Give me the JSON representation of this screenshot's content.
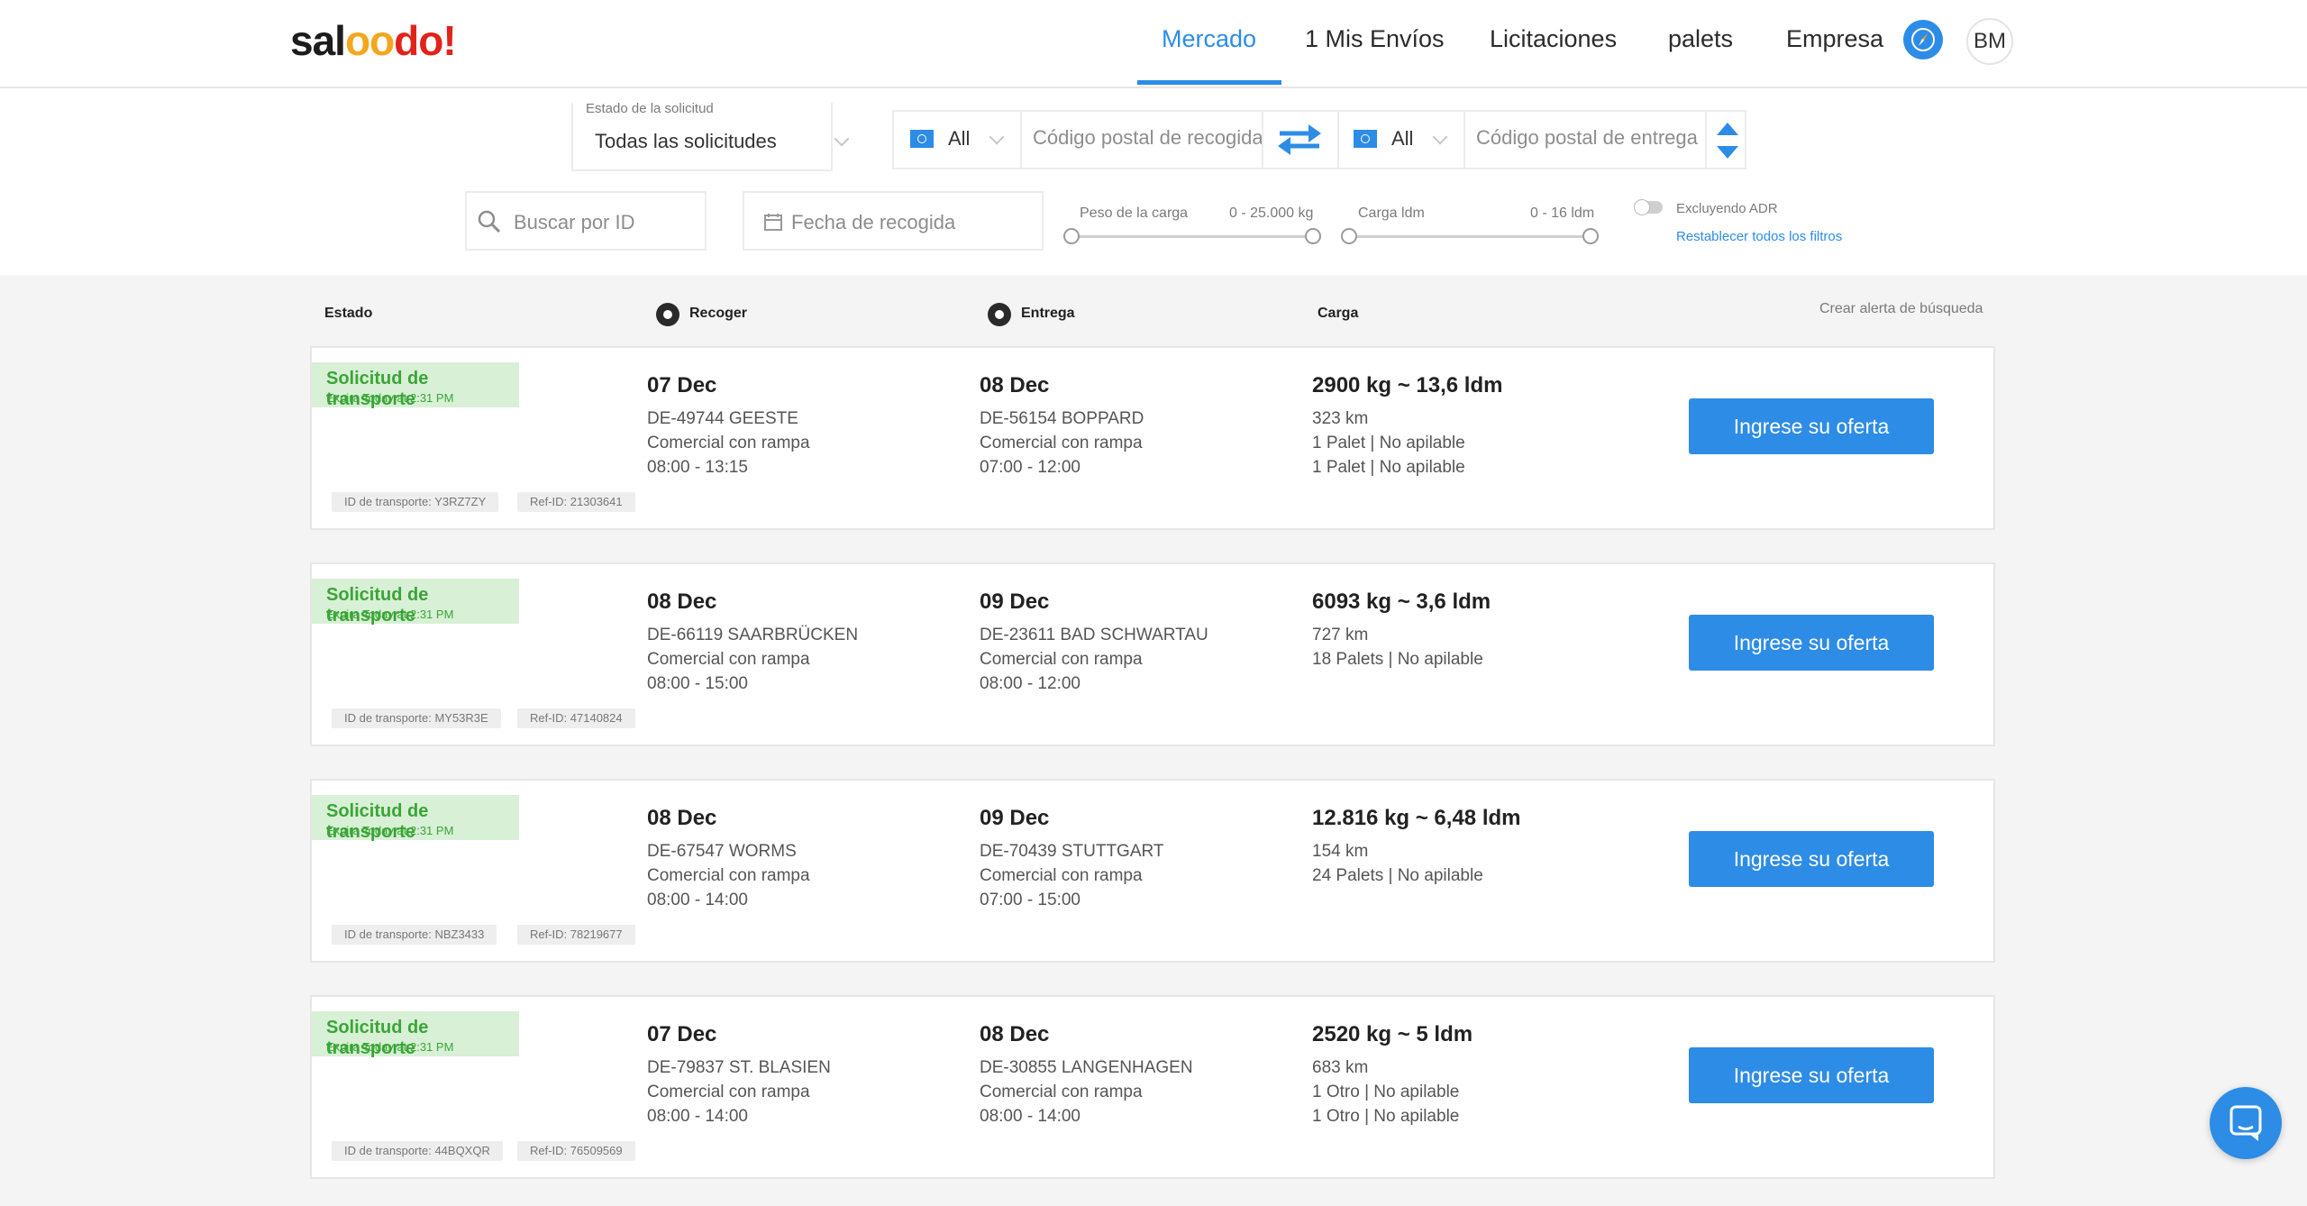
{
  "brand": {
    "logo_part1": "sal",
    "logo_part2": "oo",
    "logo_part3": "do!"
  },
  "nav": {
    "items": [
      {
        "label": "Mercado",
        "active": true
      },
      {
        "label": "1 Mis Envíos"
      },
      {
        "label": "Licitaciones"
      },
      {
        "label": "palets"
      },
      {
        "label": "Empresa"
      }
    ],
    "avatar_initials": "BM"
  },
  "filters": {
    "status_label": "Estado de la solicitud",
    "status_value": "Todas las solicitudes",
    "pickup_country": "All",
    "pickup_zip_placeholder": "Código postal de recogida",
    "delivery_country": "All",
    "delivery_zip_placeholder": "Código postal de entrega",
    "search_id_placeholder": "Buscar por ID",
    "pickup_date_placeholder": "Fecha de recogida",
    "weight_label": "Peso de la carga",
    "weight_range": "0 - 25.000 kg",
    "ldm_label": "Carga ldm",
    "ldm_range": "0 - 16 ldm",
    "adr_label": "Excluyendo ADR",
    "reset_link": "Restablecer todos los filtros"
  },
  "columns": {
    "estado": "Estado",
    "recoger": "Recoger",
    "entrega": "Entrega",
    "carga": "Carga",
    "alert": "Crear alerta de búsqueda"
  },
  "listings": [
    {
      "status": "Solicitud de transporte",
      "expires": "Expira Today at 2:31 PM",
      "transport_id": "ID de transporte: Y3RZ7ZY",
      "ref_id": "Ref-ID: 21303641",
      "pickup": {
        "date": "07 Dec",
        "place": "DE-49744 GEESTE",
        "type": "Comercial con rampa",
        "hours": "08:00 - 13:15"
      },
      "delivery": {
        "date": "08 Dec",
        "place": "DE-56154 BOPPARD",
        "type": "Comercial con rampa",
        "hours": "07:00 - 12:00"
      },
      "cargo": {
        "weight": "2900 kg ~ 13,6 ldm",
        "distance": "323 km",
        "lines": [
          "1 Palet | No apilable",
          "1 Palet | No apilable"
        ]
      },
      "button": "Ingrese su oferta"
    },
    {
      "status": "Solicitud de transporte",
      "expires": "Expira Today at 2:31 PM",
      "transport_id": "ID de transporte: MY53R3E",
      "ref_id": "Ref-ID: 47140824",
      "pickup": {
        "date": "08 Dec",
        "place": "DE-66119 SAARBRÜCKEN",
        "type": "Comercial con rampa",
        "hours": "08:00 - 15:00"
      },
      "delivery": {
        "date": "09 Dec",
        "place": "DE-23611 BAD SCHWARTAU",
        "type": "Comercial con rampa",
        "hours": "08:00 - 12:00"
      },
      "cargo": {
        "weight": "6093 kg ~ 3,6 ldm",
        "distance": "727 km",
        "lines": [
          "18 Palets | No apilable"
        ]
      },
      "button": "Ingrese su oferta"
    },
    {
      "status": "Solicitud de transporte",
      "expires": "Expira Today at 2:31 PM",
      "transport_id": "ID de transporte: NBZ3433",
      "ref_id": "Ref-ID: 78219677",
      "pickup": {
        "date": "08 Dec",
        "place": "DE-67547 WORMS",
        "type": "Comercial con rampa",
        "hours": "08:00 - 14:00"
      },
      "delivery": {
        "date": "09 Dec",
        "place": "DE-70439 STUTTGART",
        "type": "Comercial con rampa",
        "hours": "07:00 - 15:00"
      },
      "cargo": {
        "weight": "12.816 kg ~ 6,48 ldm",
        "distance": "154 km",
        "lines": [
          "24 Palets | No apilable"
        ]
      },
      "button": "Ingrese su oferta"
    },
    {
      "status": "Solicitud de transporte",
      "expires": "Expira Today at 2:31 PM",
      "transport_id": "ID de transporte: 44BQXQR",
      "ref_id": "Ref-ID: 76509569",
      "pickup": {
        "date": "07 Dec",
        "place": "DE-79837 ST. BLASIEN",
        "type": "Comercial con rampa",
        "hours": "08:00 - 14:00"
      },
      "delivery": {
        "date": "08 Dec",
        "place": "DE-30855 LANGENHAGEN",
        "type": "Comercial con rampa",
        "hours": "08:00 - 14:00"
      },
      "cargo": {
        "weight": "2520 kg ~ 5 ldm",
        "distance": "683 km",
        "lines": [
          "1 Otro | No apilable",
          "1 Otro | No apilable"
        ]
      },
      "button": "Ingrese su oferta"
    }
  ],
  "colors": {
    "accent": "#2d8ce6",
    "status_green": "#3aa537",
    "status_bg": "#d8f0d6"
  },
  "icons": [
    "compass-icon",
    "swap-arrows-icon",
    "sort-arrows-icon",
    "search-icon",
    "calendar-icon",
    "pickup-pin-icon",
    "delivery-pin-icon",
    "chat-icon"
  ]
}
